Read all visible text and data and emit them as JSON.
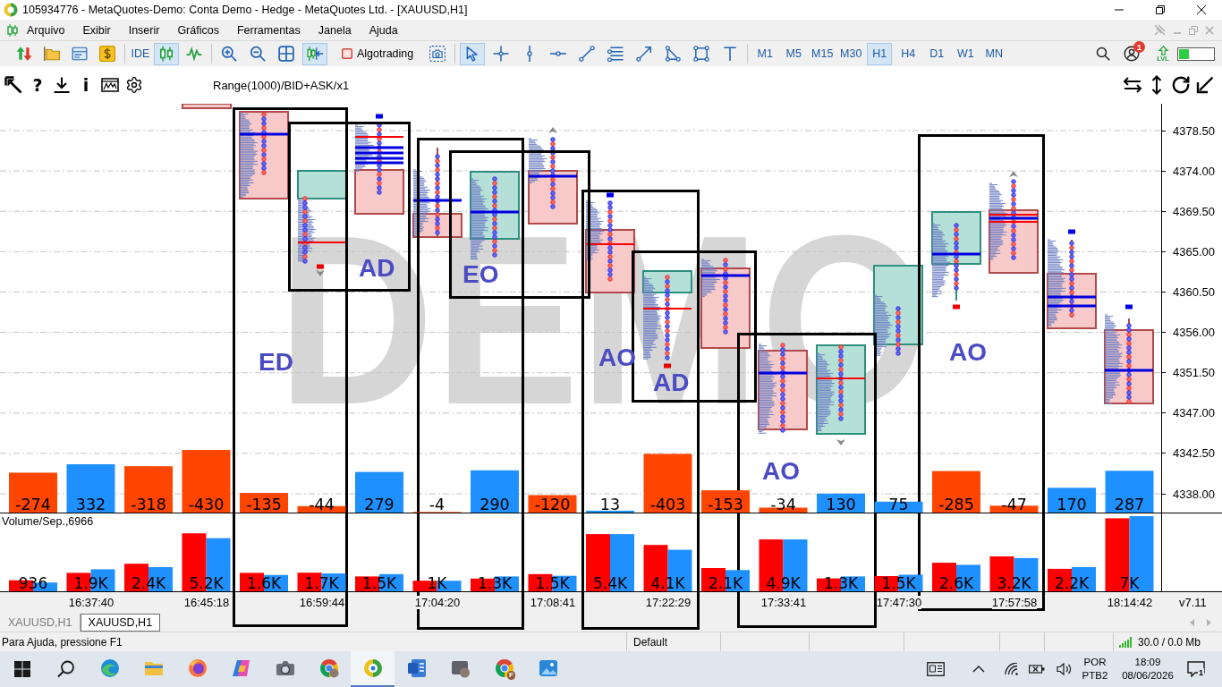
{
  "window": {
    "title": "105934776 - MetaQuotes-Demo: Conta Demo - Hedge - MetaQuotes Ltd. - [XAUUSD,H1]"
  },
  "menu": [
    "Arquivo",
    "Exibir",
    "Inserir",
    "Gráficos",
    "Ferramentas",
    "Janela",
    "Ajuda"
  ],
  "toolbar": {
    "groups": [
      [
        {
          "kind": "icon",
          "selected": false
        },
        {
          "kind": "icon",
          "selected": false
        },
        {
          "kind": "icon",
          "selected": false
        },
        {
          "kind": "icon",
          "selected": false
        }
      ],
      [
        {
          "kind": "text",
          "label": "IDE",
          "selected": false
        },
        {
          "kind": "icon",
          "selected": true
        },
        {
          "kind": "icon",
          "selected": false
        }
      ],
      [
        {
          "kind": "icon",
          "selected": false
        },
        {
          "kind": "icon",
          "selected": false
        },
        {
          "kind": "icon",
          "selected": false
        },
        {
          "kind": "icon",
          "selected": true
        },
        {
          "kind": "toggle",
          "label": "Algotrading",
          "on": false
        },
        {
          "kind": "icon",
          "selected": false
        }
      ],
      [
        {
          "kind": "icon",
          "selected": true
        },
        {
          "kind": "icon",
          "selected": false
        },
        {
          "kind": "icon",
          "selected": false
        },
        {
          "kind": "icon",
          "selected": false
        },
        {
          "kind": "icon",
          "selected": false
        },
        {
          "kind": "icon",
          "selected": false
        },
        {
          "kind": "icon",
          "selected": false
        },
        {
          "kind": "icon",
          "selected": false
        },
        {
          "kind": "icon",
          "selected": false
        },
        {
          "kind": "icon",
          "selected": false
        }
      ],
      [
        {
          "kind": "text",
          "label": "M1",
          "selected": false
        },
        {
          "kind": "text",
          "label": "M5",
          "selected": false
        },
        {
          "kind": "text",
          "label": "M15",
          "selected": false
        },
        {
          "kind": "text",
          "label": "M30",
          "selected": false
        },
        {
          "kind": "text",
          "label": "H1",
          "selected": true
        },
        {
          "kind": "text",
          "label": "H4",
          "selected": false
        },
        {
          "kind": "text",
          "label": "D1",
          "selected": false
        },
        {
          "kind": "text",
          "label": "W1",
          "selected": false
        },
        {
          "kind": "text",
          "label": "MN",
          "selected": false
        }
      ]
    ],
    "account_badge": "1",
    "level_label": "LVL"
  },
  "chart": {
    "indicator_label": "Range(1000)/BID+ASK/x1",
    "help_label": "?",
    "info_label": "i",
    "account_label": "DEMO",
    "price_axis": [
      "4378.50",
      "4374.00",
      "4369.50",
      "4365.00",
      "4360.50",
      "4356.00",
      "4351.50",
      "4347.00",
      "4342.50",
      "4338.00"
    ],
    "delta": {
      "labels": [
        "-274",
        "332",
        "-318",
        "-430",
        "-135",
        "-44",
        "279",
        "-4",
        "290",
        "-120",
        "13",
        "-403",
        "-153",
        "-34",
        "130",
        "75",
        "-285",
        "-47",
        "170",
        "287"
      ]
    },
    "volume": {
      "title": "Volume/Sep.,6966",
      "labels": [
        "936",
        "1.9K",
        "2.4K",
        "5.2K",
        "1.6K",
        "1.7K",
        "1.5K",
        "1K",
        "1.3K",
        "1.5K",
        "5.4K",
        "4.1K",
        "2.1K",
        "4.9K",
        "1.3K",
        "1.5K",
        "2.6K",
        "3.2K",
        "2.2K",
        "7K"
      ]
    },
    "time_axis": [
      "16:37:40",
      "16:45:18",
      "16:59:44",
      "17:04:20",
      "17:08:41",
      "17:22:29",
      "17:33:41",
      "17:47:30",
      "17:57:58",
      "18:14:42"
    ],
    "version": "v7.11",
    "annotation_labels": [
      "ED",
      "AD",
      "EO",
      "AO",
      "AD",
      "AO",
      "AO"
    ]
  },
  "tabs": [
    {
      "label": "XAUUSD,H1",
      "selected": false
    },
    {
      "label": "XAUUSD,H1",
      "selected": true
    }
  ],
  "status_bar": {
    "help": "Para Ajuda, pressione F1",
    "profile": "Default",
    "traffic": "30.0 / 0.0 Mb"
  },
  "taskbar": {
    "apps": [
      {
        "selected": false
      },
      {
        "selected": false
      },
      {
        "selected": false
      },
      {
        "selected": false
      },
      {
        "selected": false
      },
      {
        "selected": false
      },
      {
        "selected": true
      },
      {
        "selected": false
      },
      {
        "selected": false
      },
      {
        "selected": false,
        "badge": "F"
      },
      {
        "selected": false
      }
    ],
    "language": "POR",
    "layout": "PTB2",
    "time": "18:09",
    "date": "08/06/2026",
    "notifications": "1"
  }
}
